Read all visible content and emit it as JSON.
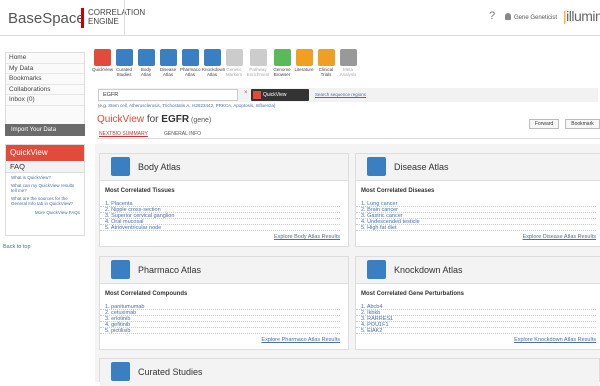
{
  "header": {
    "brand": "BaseSpace",
    "brand_ce_1": "CORRELATION",
    "brand_ce_2": "ENGINE",
    "help": "?",
    "user": "Gene Geneticist",
    "logo": "illumina"
  },
  "sidenav": {
    "items": [
      "Home",
      "My Data",
      "Bookmarks",
      "Collaborations",
      "Inbox (0)"
    ],
    "import": "Import Your Data"
  },
  "quickview": {
    "header": "QuickView",
    "faq": "FAQ",
    "faq_items": [
      "What is QuickView?",
      "What can my QuickView results tell me?",
      "What are the sources for the General Info tab in QuickView?"
    ],
    "more": "More QuickView FAQs"
  },
  "back_to_top": "Back to top",
  "toolbar": [
    {
      "label": "QuickView",
      "color": "#e24a3b",
      "disabled": false
    },
    {
      "label": "Curated Studies",
      "color": "#3a7fc1",
      "disabled": false
    },
    {
      "label": "Body Atlas",
      "color": "#3a7fc1",
      "disabled": false
    },
    {
      "label": "Disease Atlas",
      "color": "#3a7fc1",
      "disabled": false
    },
    {
      "label": "Pharmaco Atlas",
      "color": "#3a7fc1",
      "disabled": false
    },
    {
      "label": "Knockdown Atlas",
      "color": "#3a7fc1",
      "disabled": false
    },
    {
      "label": "Genetic Markers",
      "color": "#cccccc",
      "disabled": true
    },
    {
      "label": "Pathway Enrichment",
      "color": "#cccccc",
      "disabled": true
    },
    {
      "label": "Genome Browser",
      "color": "#5bb85b",
      "disabled": false
    },
    {
      "label": "Literature",
      "color": "#f0a020",
      "disabled": false
    },
    {
      "label": "Clinical Trials",
      "color": "#f0a020",
      "disabled": false
    },
    {
      "label": "Meta Analysis",
      "color": "#999999",
      "disabled": true
    }
  ],
  "search": {
    "value": "EGFR",
    "clear": "×",
    "button": "QuickView",
    "link": "Search sequence regions",
    "examples_prefix": "(e.g. ",
    "examples": "Stem cell, Atherosclerosis, Trichostatin A, rs2823442, PRKCA, Apoptosis, Influenza)"
  },
  "page": {
    "title_prefix": "QuickView",
    "title_for": " for ",
    "title_gene": "EGFR",
    "title_suffix": " (gene)",
    "forward": "Forward",
    "bookmark": "Bookmark",
    "tab_nextbio": "NEXTBIO SUMMARY",
    "tab_general": "GENERAL INFO"
  },
  "cards": [
    {
      "title": "Body Atlas",
      "subtitle": "Most Correlated Tissues",
      "items": [
        "Placenta",
        "Nipple cross-section",
        "Superior cervical ganglion",
        "Oral mucosal",
        "Atrioventricular node"
      ],
      "link": "Explore Body Atlas Results"
    },
    {
      "title": "Disease Atlas",
      "subtitle": "Most Correlated Diseases",
      "items": [
        "Lung cancer",
        "Brain cancer",
        "Gastric cancer",
        "Undescended testicle",
        "High fat diet"
      ],
      "link": "Explore Disease Atlas Results"
    },
    {
      "title": "Pharmaco Atlas",
      "subtitle": "Most Correlated Compounds",
      "items": [
        "panitumumab",
        "cetuximab",
        "erlotinib",
        "gefitinib",
        "pictilisib"
      ],
      "link": "Explore Pharmaco Atlas Results"
    },
    {
      "title": "Knockdown Atlas",
      "subtitle": "Most Correlated Gene Perturbations",
      "items": [
        "Abcb4",
        "Ikbkb",
        "RARRES1",
        "POU1F1",
        "ElAK2"
      ],
      "link": "Explore Knockdown Atlas Results"
    },
    {
      "title": "Curated Studies"
    }
  ]
}
